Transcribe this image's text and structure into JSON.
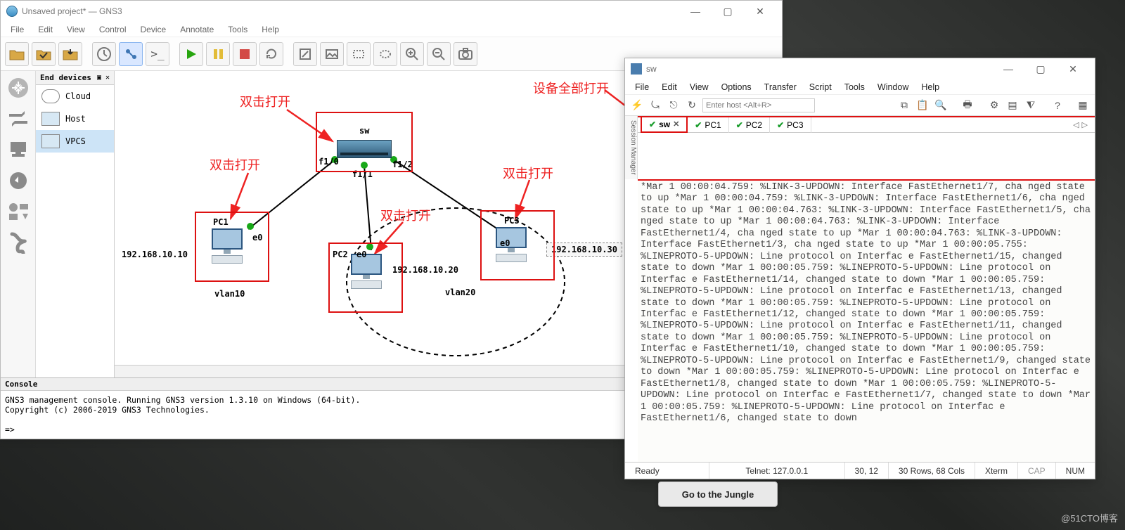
{
  "gns3": {
    "title": "Unsaved project* — GNS3",
    "menus": [
      "File",
      "Edit",
      "View",
      "Control",
      "Device",
      "Annotate",
      "Tools",
      "Help"
    ],
    "devices_panel": {
      "title": "End devices",
      "items": [
        {
          "label": "Cloud"
        },
        {
          "label": "Host"
        },
        {
          "label": "VPCS"
        }
      ]
    },
    "console_title": "Console",
    "console_text": "GNS3 management console. Running GNS3 version 1.3.10 on Windows (64-bit).\nCopyright (c) 2006-2019 GNS3 Technologies.\n\n=>",
    "topology": {
      "switch_label": "sw",
      "ports": {
        "f10": "f1/0",
        "f11": "f1/1",
        "f12": "f1/2"
      },
      "pc1": {
        "name": "PC1",
        "iface": "e0",
        "ip": "192.168.10.10",
        "vlan": "vlan10"
      },
      "pc2": {
        "name": "PC2",
        "iface": "e0",
        "ip": "192.168.10.20"
      },
      "pc3": {
        "name": "PC3",
        "iface": "e0",
        "ip": "192.168.10.30",
        "vlan": "vlan20"
      }
    },
    "annotations": {
      "open_dbl": "双击打开",
      "open_all": "设备全部打开"
    }
  },
  "crt": {
    "title": "sw",
    "menus": [
      "File",
      "Edit",
      "View",
      "Options",
      "Transfer",
      "Script",
      "Tools",
      "Window",
      "Help"
    ],
    "host_placeholder": "Enter host <Alt+R>",
    "session_label": "Session Manager",
    "tabs": [
      {
        "label": "sw",
        "active": true,
        "closable": true
      },
      {
        "label": "PC1"
      },
      {
        "label": "PC2"
      },
      {
        "label": "PC3"
      }
    ],
    "log": "*Mar  1 00:00:04.759: %LINK-3-UPDOWN: Interface FastEthernet1/7, cha\nnged state to up\n*Mar  1 00:00:04.759: %LINK-3-UPDOWN: Interface FastEthernet1/6, cha\nnged state to up\n*Mar  1 00:00:04.763: %LINK-3-UPDOWN: Interface FastEthernet1/5, cha\nnged state to up\n*Mar  1 00:00:04.763: %LINK-3-UPDOWN: Interface FastEthernet1/4, cha\nnged state to up\n*Mar  1 00:00:04.763: %LINK-3-UPDOWN: Interface FastEthernet1/3, cha\nnged state to up\n*Mar  1 00:00:05.755: %LINEPROTO-5-UPDOWN: Line protocol on Interfac\ne FastEthernet1/15, changed state to down\n*Mar  1 00:00:05.759: %LINEPROTO-5-UPDOWN: Line protocol on Interfac\ne FastEthernet1/14, changed state to down\n*Mar  1 00:00:05.759: %LINEPROTO-5-UPDOWN: Line protocol on Interfac\ne FastEthernet1/13, changed state to down\n*Mar  1 00:00:05.759: %LINEPROTO-5-UPDOWN: Line protocol on Interfac\ne FastEthernet1/12, changed state to down\n*Mar  1 00:00:05.759: %LINEPROTO-5-UPDOWN: Line protocol on Interfac\ne FastEthernet1/11, changed state to down\n*Mar  1 00:00:05.759: %LINEPROTO-5-UPDOWN: Line protocol on Interfac\ne FastEthernet1/10, changed state to down\n*Mar  1 00:00:05.759: %LINEPROTO-5-UPDOWN: Line protocol on Interfac\ne FastEthernet1/9, changed state to down\n*Mar  1 00:00:05.759: %LINEPROTO-5-UPDOWN: Line protocol on Interfac\ne FastEthernet1/8, changed state to down\n*Mar  1 00:00:05.759: %LINEPROTO-5-UPDOWN: Line protocol on Interfac\ne FastEthernet1/7, changed state to down\n*Mar  1 00:00:05.759: %LINEPROTO-5-UPDOWN: Line protocol on Interfac\ne FastEthernet1/6, changed state to down",
    "status": {
      "ready": "Ready",
      "conn": "Telnet: 127.0.0.1",
      "pos": "30, 12",
      "size": "30 Rows, 68 Cols",
      "term": "Xterm",
      "cap": "CAP",
      "num": "NUM"
    }
  },
  "jungle_label": "Go to the Jungle",
  "watermark": "@51CTO博客"
}
